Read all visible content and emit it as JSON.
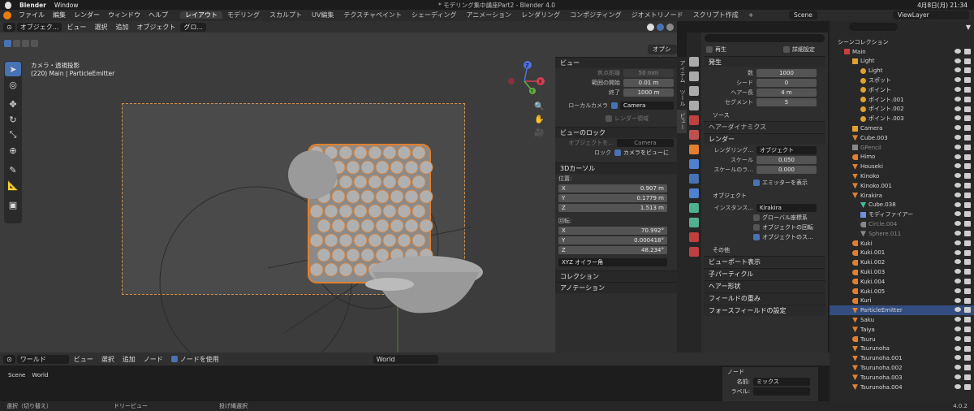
{
  "mac": {
    "app": "Blender",
    "window": "Window",
    "title": "* モデリング集中講座Part2 - Blender 4.0",
    "date": "4月8日(月) 21:34"
  },
  "menus": [
    "ファイル",
    "編集",
    "レンダー",
    "ウィンドウ",
    "ヘルプ"
  ],
  "workspaces": [
    "レイアウト",
    "モデリング",
    "スカルプト",
    "UV編集",
    "テクスチャペイント",
    "シェーディング",
    "アニメーション",
    "レンダリング",
    "コンポジティング",
    "ジオメトリノード",
    "スクリプト作成"
  ],
  "scene": {
    "scene_name": "Scene",
    "view_layer": "ViewLayer",
    "plus": "+"
  },
  "viewport": {
    "mode": "オブジェク...",
    "menus": [
      "ビュー",
      "選択",
      "追加",
      "オブジェクト"
    ],
    "orientation": "グロ...",
    "options": "オプション",
    "cam_title": "カメラ・透視投影",
    "cam_sub": "(220) Main | ParticleEmitter",
    "gizmo": {
      "x": "X",
      "y": "Y",
      "z": "Z"
    }
  },
  "npanel": {
    "view_header": "ビュー",
    "focal_label": "焦点距離",
    "focal": "50 mm",
    "clip_start_label": "範囲の開始",
    "clip_start": "0.01 m",
    "clip_end_label": "終了",
    "clip_end": "1000 m",
    "local_cam_label": "ローカルカメラ",
    "local_cam": "Camera",
    "render_region": "レンダー領域",
    "lock_header": "ビューのロック",
    "lock_obj_label": "オブジェクトを...",
    "lock_obj": "Camera",
    "lock_label": "ロック",
    "lock_cam": "カメラをビューに",
    "cursor_header": "3Dカーソル",
    "loc_label": "位置:",
    "x": "X",
    "y": "Y",
    "z": "Z",
    "loc_x": "0.907 m",
    "loc_y": "0.1779 m",
    "loc_z": "1.513 m",
    "rot_label": "回転:",
    "rot_x": "70.992°",
    "rot_y": "0.000418°",
    "rot_z": "48.234°",
    "rot_mode": "XYZ オイラー角",
    "collection": "コレクション",
    "annotation": "アノテーション"
  },
  "vtabs": [
    "アイテム",
    "ツール",
    "ビュー"
  ],
  "props": {
    "playback": "再生",
    "detail": "詳細設定",
    "emission": "発生",
    "number_label": "数",
    "number": "1000",
    "seed_label": "シード",
    "seed": "0",
    "hair_len_label": "ヘアー長",
    "hair_len": "4 m",
    "segments_label": "セグメント",
    "segments": "5",
    "source": "ソース",
    "hair_dyn": "ヘアーダイナミクス",
    "render": "レンダー",
    "render_as_label": "レンダリング...",
    "render_as": "オブジェクト",
    "scale_label": "スケール",
    "scale": "0.050",
    "scale_rand_label": "スケールのラ...",
    "scale_rand": "0.000",
    "show_emitter": "エミッターを表示",
    "object_sub": "オブジェクト",
    "inst_label": "インスタンス...",
    "inst": "Kirakira",
    "global": "グローバル座標系",
    "obj_rot": "オブジェクトの回転",
    "obj_scale": "オブジェクトのス...",
    "other": "その他",
    "viewport_disp": "ビューポート表示",
    "children": "子パーティクル",
    "hair_shape": "ヘアー形状",
    "field_weights": "フィールドの重み",
    "force_field": "フォースフィールドの設定"
  },
  "outliner": {
    "root": "シーンコレクション",
    "rows": [
      {
        "n": "Main",
        "d": 0,
        "c": "#c84040",
        "t": "col"
      },
      {
        "n": "Light",
        "d": 1,
        "c": "#e0a030",
        "t": "col"
      },
      {
        "n": "Light",
        "d": 2,
        "c": "#e0a030",
        "t": "light"
      },
      {
        "n": "スポット",
        "d": 2,
        "c": "#e0a030",
        "t": "light"
      },
      {
        "n": "ポイント",
        "d": 2,
        "c": "#e0a030",
        "t": "light"
      },
      {
        "n": "ポイント.001",
        "d": 2,
        "c": "#e0a030",
        "t": "light"
      },
      {
        "n": "ポイント.002",
        "d": 2,
        "c": "#e0a030",
        "t": "light"
      },
      {
        "n": "ポイント.003",
        "d": 2,
        "c": "#e0a030",
        "t": "light"
      },
      {
        "n": "Camera",
        "d": 1,
        "c": "#e0a030",
        "t": "cam"
      },
      {
        "n": "Cube.003",
        "d": 1,
        "c": "#e08030",
        "t": "mesh"
      },
      {
        "n": "GPencil",
        "d": 1,
        "c": "#888",
        "t": "gp",
        "dim": true
      },
      {
        "n": "Himo",
        "d": 1,
        "c": "#e08030",
        "t": "curve"
      },
      {
        "n": "Houseki",
        "d": 1,
        "c": "#e08030",
        "t": "mesh"
      },
      {
        "n": "Kinoko",
        "d": 1,
        "c": "#e08030",
        "t": "mesh"
      },
      {
        "n": "Kinoko.001",
        "d": 1,
        "c": "#e08030",
        "t": "mesh"
      },
      {
        "n": "Kirakira",
        "d": 1,
        "c": "#e08030",
        "t": "mesh"
      },
      {
        "n": "Cube.038",
        "d": 2,
        "c": "#40c0a0",
        "t": "mesh"
      },
      {
        "n": "モディファイアー",
        "d": 2,
        "c": "#7090e0",
        "t": "mod"
      },
      {
        "n": "Circle.004",
        "d": 2,
        "c": "#888",
        "t": "curve",
        "dim": true
      },
      {
        "n": "Sphere.011",
        "d": 2,
        "c": "#888",
        "t": "mesh",
        "dim": true
      },
      {
        "n": "Kuki",
        "d": 1,
        "c": "#e08030",
        "t": "curve"
      },
      {
        "n": "Kuki.001",
        "d": 1,
        "c": "#e08030",
        "t": "curve"
      },
      {
        "n": "Kuki.002",
        "d": 1,
        "c": "#e08030",
        "t": "curve"
      },
      {
        "n": "Kuki.003",
        "d": 1,
        "c": "#e08030",
        "t": "curve"
      },
      {
        "n": "Kuki.004",
        "d": 1,
        "c": "#e08030",
        "t": "curve"
      },
      {
        "n": "Kuki.005",
        "d": 1,
        "c": "#e08030",
        "t": "curve"
      },
      {
        "n": "Kuri",
        "d": 1,
        "c": "#e08030",
        "t": "curve"
      },
      {
        "n": "ParticleEmitter",
        "d": 1,
        "c": "#e08030",
        "t": "mesh",
        "sel": true
      },
      {
        "n": "Saku",
        "d": 1,
        "c": "#e08030",
        "t": "mesh"
      },
      {
        "n": "Taiya",
        "d": 1,
        "c": "#e08030",
        "t": "mesh"
      },
      {
        "n": "Tsuru",
        "d": 1,
        "c": "#e08030",
        "t": "curve"
      },
      {
        "n": "Tsurunoha",
        "d": 1,
        "c": "#e08030",
        "t": "mesh"
      },
      {
        "n": "Tsurunoha.001",
        "d": 1,
        "c": "#e08030",
        "t": "mesh"
      },
      {
        "n": "Tsurunoha.002",
        "d": 1,
        "c": "#e08030",
        "t": "mesh"
      },
      {
        "n": "Tsurunoha.003",
        "d": 1,
        "c": "#e08030",
        "t": "mesh"
      },
      {
        "n": "Tsurunoha.004",
        "d": 1,
        "c": "#e08030",
        "t": "mesh"
      }
    ]
  },
  "node": {
    "world_type": "ワールド",
    "menus": [
      "ビュー",
      "選択",
      "追加",
      "ノード"
    ],
    "use_nodes": "ノードを使用",
    "world": "World",
    "crumb_scene": "Scene",
    "crumb_world": "World",
    "panel_node": "ノード",
    "name_label": "名前:",
    "name": "ミックス",
    "label_label": "ラベル:"
  },
  "status": {
    "select": "選択（切り替え）",
    "dolly": "ドリービュー",
    "lasso": "投げ縄選択",
    "version": "4.0.2"
  }
}
